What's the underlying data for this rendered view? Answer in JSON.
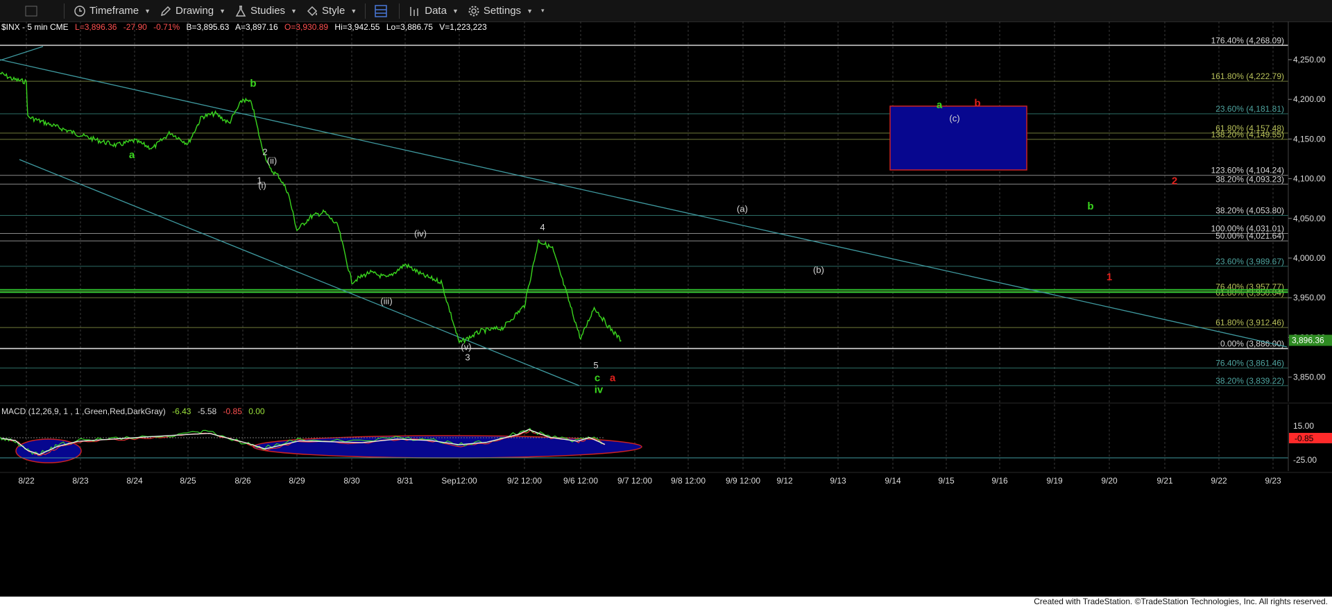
{
  "toolbar": {
    "timeframe_label": "Timeframe",
    "drawing_label": "Drawing",
    "studies_label": "Studies",
    "style_label": "Style",
    "data_label": "Data",
    "settings_label": "Settings"
  },
  "header": {
    "symbol": "$INX - 5 min  CME",
    "last": "L=3,896.36",
    "change": "-27.90",
    "change_pct": "-0.71%",
    "bid": "B=3,895.63",
    "ask": "A=3,897.16",
    "open": "O=3,930.89",
    "high": "Hi=3,942.55",
    "low": "Lo=3,886.75",
    "volume": "V=1,223,223"
  },
  "macd": {
    "title": "MACD (12,26,9, 1 , 1 ,Green,Red,DarkGray)",
    "v1": "-6.43",
    "v2": "-5.58",
    "v3": "-0.85",
    "v4": "0.00",
    "axis_ticks": [
      15.0,
      -25.0
    ],
    "axis_labels": [
      "15.00",
      "-25.00"
    ],
    "current_label": "-0.85"
  },
  "footer_text": "Created with TradeStation. ©TradeStation Technologies, Inc. All rights reserved.",
  "colors": {
    "price": "#3ad61e",
    "trendline": "#3f9aa0",
    "up_label": "#3ad61e",
    "down_label": "#e0211d",
    "box_fill": "#07078f",
    "box_border": "#cc2222",
    "last_price_bg": "#2e8b22"
  },
  "chart_data": {
    "type": "line",
    "series": [
      {
        "x": [
          "8/22",
          "8/22",
          "8/22",
          "8/22",
          "8/23",
          "8/23",
          "8/23",
          "8/24",
          "8/24",
          "8/24",
          "8/25",
          "8/25",
          "8/25",
          "8/25",
          "8/26",
          "8/26",
          "8/26",
          "8/26",
          "8/26",
          "8/26",
          "8/29",
          "8/29",
          "8/29",
          "8/29",
          "8/30",
          "8/30",
          "8/30",
          "8/31",
          "8/31",
          "8/31",
          "Sep12:00",
          "Sep12:00",
          "Sep12:00",
          "9/2 12:00",
          "9/2 12:00",
          "9/2 12:00",
          "9/2 12:00",
          "9/6 12:00",
          "9/6 12:00",
          "9/6 12:00",
          "9/6 12:00"
        ],
        "values": [
          4233,
          4225,
          4222,
          4178,
          4155,
          4148,
          4142,
          4148,
          4138,
          4158,
          4144,
          4178,
          4182,
          4170,
          4200,
          4195,
          4145,
          4112,
          4103,
          4083,
          4035,
          4052,
          4058,
          4040,
          3970,
          3982,
          3975,
          3992,
          3978,
          3970,
          3893,
          3908,
          3912,
          3940,
          4022,
          4012,
          3955,
          3898,
          3938,
          3915,
          3896
        ]
      }
    ],
    "y_axis_ticks": [
      4250,
      4200,
      4150,
      4100,
      4050,
      4000,
      3950,
      3900,
      3850
    ],
    "y_axis_labels": [
      "4,250.00",
      "4,200.00",
      "4,150.00",
      "4,100.00",
      "4,050.00",
      "4,000.00",
      "3,950.00",
      "3,900.00",
      "3,850.00"
    ],
    "x_tick_labels": [
      "8/22",
      "8/23",
      "8/24",
      "8/25",
      "8/26",
      "8/29",
      "8/30",
      "8/31",
      "Sep12:00",
      "9/2 12:00",
      "9/6 12:00",
      "9/7 12:00",
      "9/8 12:00",
      "9/9 12:00",
      "9/12",
      "9/13",
      "9/14",
      "9/15",
      "9/16",
      "9/19",
      "9/20",
      "9/21",
      "9/22",
      "9/23"
    ],
    "last_price_label": "3,896.36",
    "last_price": 3896.36,
    "fib_levels": [
      {
        "value": 4268.09,
        "label": "176.40% (4,268.09)"
      },
      {
        "value": 4222.79,
        "label": "161.80% (4,222.79)"
      },
      {
        "value": 4181.81,
        "label": "23.60% (4,181.81)"
      },
      {
        "value": 4157.48,
        "label": "61.80% (4,157.48)"
      },
      {
        "value": 4149.55,
        "label": "138.20% (4,149.55)"
      },
      {
        "value": 4104.24,
        "label": "123.60% (4,104.24)"
      },
      {
        "value": 4093.23,
        "label": "38.20% (4,093.23)"
      },
      {
        "value": 4053.8,
        "label": "38.20% (4,053.80)"
      },
      {
        "value": 4031.01,
        "label": "100.00% (4,031.01)"
      },
      {
        "value": 4021.64,
        "label": "50.00% (4,021.64)"
      },
      {
        "value": 3989.67,
        "label": "23.60% (3,989.67)"
      },
      {
        "value": 3957.77,
        "label": "76.40% (3,957.77)"
      },
      {
        "value": 3950.04,
        "label": "61.80% (3,950.04)"
      },
      {
        "value": 3912.46,
        "label": "61.80% (3,912.46)"
      },
      {
        "value": 3886.0,
        "label": "0.00% (3,886.00)"
      },
      {
        "value": 3861.46,
        "label": "76.40% (3,861.46)"
      },
      {
        "value": 3839.22,
        "label": "38.20% (3,839.22)"
      }
    ],
    "green_levels": [
      3960,
      3957
    ],
    "annotations": [
      {
        "text": "a",
        "x": "8/24",
        "y": 4126,
        "color": "green"
      },
      {
        "text": "b",
        "x": "8/26",
        "y": 4216,
        "color": "green"
      },
      {
        "text": "1",
        "x": "8/26",
        "y": 4094,
        "color": "white"
      },
      {
        "text": "(i)",
        "x": "8/26",
        "y": 4088,
        "color": "white"
      },
      {
        "text": "2",
        "x": "8/26",
        "y": 4130,
        "color": "white"
      },
      {
        "text": "(ii)",
        "x": "8/26",
        "y": 4119,
        "color": "white"
      },
      {
        "text": "(iii)",
        "x": "8/30",
        "y": 3942,
        "color": "white"
      },
      {
        "text": "(iv)",
        "x": "8/31",
        "y": 4027,
        "color": "white"
      },
      {
        "text": "(v)",
        "x": "Sep12:00",
        "y": 3884,
        "color": "white"
      },
      {
        "text": "3",
        "x": "Sep12:00",
        "y": 3871,
        "color": "white"
      },
      {
        "text": "4",
        "x": "9/2 12:00",
        "y": 4035,
        "color": "white"
      },
      {
        "text": "5",
        "x": "9/6 12:00",
        "y": 3861,
        "color": "white"
      },
      {
        "text": "c",
        "x": "9/6 12:00",
        "y": 3845,
        "color": "green"
      },
      {
        "text": "iv",
        "x": "9/6 12:00",
        "y": 3830,
        "color": "green"
      },
      {
        "text": "a",
        "x": "9/6 12:00",
        "y": 3845,
        "color": "red"
      },
      {
        "text": "(a)",
        "x": "9/8 12:00",
        "y": 4058,
        "color": "white"
      },
      {
        "text": "(b)",
        "x": "9/9 12:00",
        "y": 3981,
        "color": "white"
      },
      {
        "text": "a",
        "x": "9/14",
        "y": 4189,
        "color": "green"
      },
      {
        "text": "b",
        "x": "9/15",
        "y": 4191,
        "color": "red"
      },
      {
        "text": "(c)",
        "x": "9/15",
        "y": 4172,
        "color": "white"
      },
      {
        "text": "b",
        "x": "9/19",
        "y": 4061,
        "color": "green"
      },
      {
        "text": "2",
        "x": "9/21",
        "y": 4093,
        "color": "red"
      },
      {
        "text": "1",
        "x": "9/20",
        "y": 3972,
        "color": "red"
      }
    ]
  }
}
